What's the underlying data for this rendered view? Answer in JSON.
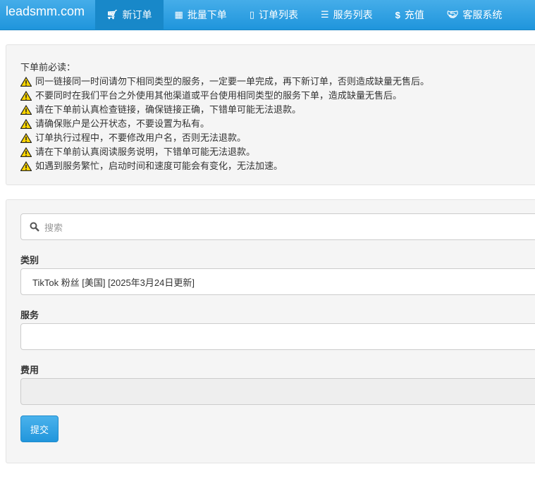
{
  "nav": {
    "brand": "leadsmm.com",
    "items": [
      {
        "label": "新订单",
        "icon": "cart-icon",
        "active": true
      },
      {
        "label": "批量下单",
        "icon": "boxes-icon"
      },
      {
        "label": "订单列表",
        "icon": "file-icon"
      },
      {
        "label": "服务列表",
        "icon": "list-icon"
      },
      {
        "label": "充值",
        "icon": "dollar-icon"
      },
      {
        "label": "客服系统",
        "icon": "handshake-icon"
      }
    ]
  },
  "notice": {
    "title": "下单前必读：",
    "items": [
      "同一链接同一时间请勿下相同类型的服务，一定要一单完成，再下新订单，否则造成缺量无售后。",
      "不要同时在我们平台之外使用其他渠道或平台使用相同类型的服务下单，造成缺量无售后。",
      "请在下单前认真检查链接，确保链接正确，下错单可能无法退款。",
      "请确保账户是公开状态，不要设置为私有。",
      "订单执行过程中，不要修改用户名，否则无法退款。",
      "请在下单前认真阅读服务说明，下错单可能无法退款。",
      "如遇到服务繁忙，启动时间和速度可能会有变化，无法加速。"
    ]
  },
  "form": {
    "search_placeholder": "搜索",
    "category_label": "类别",
    "category_value": "TikTok 粉丝 [美国] [2025年3月24日更新]",
    "service_label": "服务",
    "service_value": "",
    "cost_label": "费用",
    "cost_value": "",
    "submit": "提交"
  },
  "colors": {
    "accent": "#2196dc",
    "warning": "#ffd700"
  }
}
